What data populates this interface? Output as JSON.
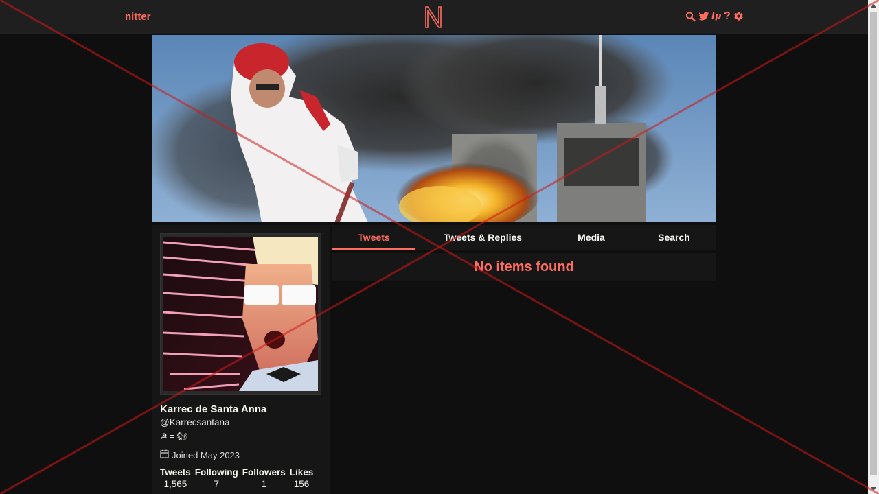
{
  "navbar": {
    "brand": "nitter",
    "logo_letter": "N",
    "icons": [
      "search-icon",
      "twitter-icon",
      "lp-icon",
      "help-icon",
      "gear-icon"
    ],
    "lp_label": "lp",
    "help_label": "?"
  },
  "profile": {
    "fullname": "Karrec de Santa Anna",
    "username": "@Karrecsantana",
    "bio": "☭ = 🐿",
    "joined": "Joined May 2023",
    "stats": [
      {
        "label": "Tweets",
        "value": "1,565"
      },
      {
        "label": "Following",
        "value": "7"
      },
      {
        "label": "Followers",
        "value": "1"
      },
      {
        "label": "Likes",
        "value": "156"
      }
    ]
  },
  "tabs": [
    {
      "label": "Tweets",
      "active": true
    },
    {
      "label": "Tweets & Replies",
      "active": false
    },
    {
      "label": "Media",
      "active": false
    },
    {
      "label": "Search",
      "active": false
    }
  ],
  "timeline": {
    "empty_message": "No items found"
  },
  "colors": {
    "accent": "#ff6c60",
    "background": "#0f0f0f",
    "panel": "#161616",
    "navbar": "#1f1f1f"
  }
}
